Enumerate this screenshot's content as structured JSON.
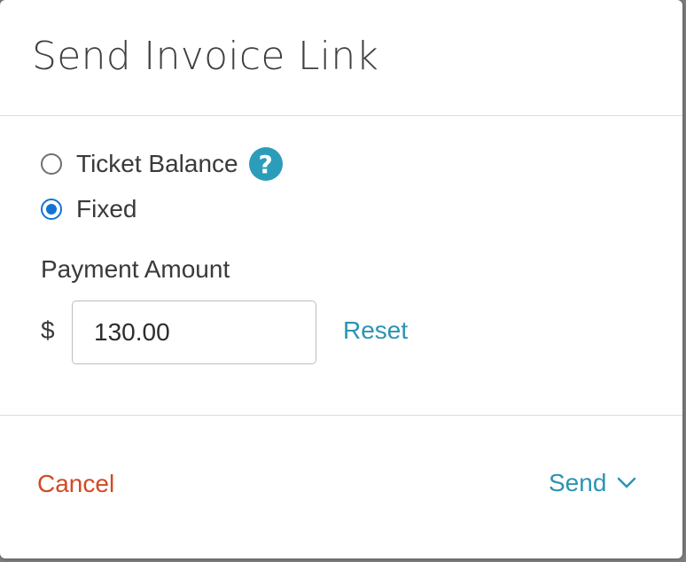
{
  "modal": {
    "title": "Send Invoice Link",
    "options": [
      {
        "label": "Ticket Balance",
        "checked": false,
        "help_icon": "help-question-icon"
      },
      {
        "label": "Fixed",
        "checked": true
      }
    ],
    "help_glyph": "?",
    "payment_amount_label": "Payment Amount",
    "currency_symbol": "$",
    "amount_value": "130.00",
    "reset_label": "Reset",
    "cancel_label": "Cancel",
    "send_label": "Send"
  },
  "colors": {
    "accent": "#2c94b3",
    "radio_selected": "#1273d6",
    "cancel": "#d14a25"
  }
}
